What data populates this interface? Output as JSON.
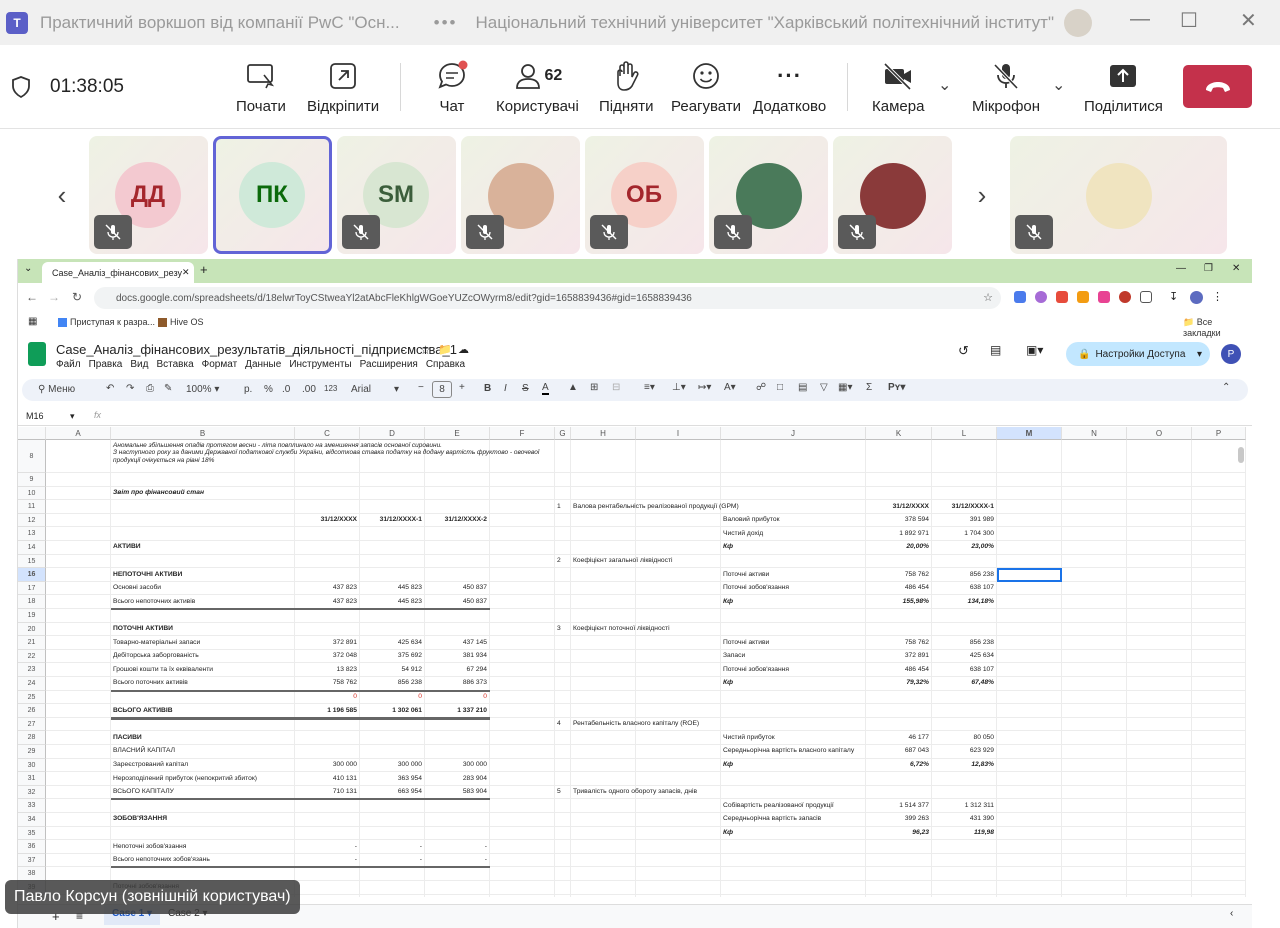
{
  "window": {
    "meeting_title": "Практичний воркшоп від компанії PwC \"Осн...",
    "more": "•••",
    "org_title": "Національний технічний університет \"Харківський політехнічний інститут\""
  },
  "toolbar": {
    "timer": "01:38:05",
    "start": "Почати",
    "undock": "Відкріпити",
    "chat": "Чат",
    "people_count": "62",
    "people": "Користувачі",
    "raise": "Підняти",
    "react": "Реагувати",
    "more": "Додатково",
    "camera": "Камера",
    "mic": "Мікрофон",
    "share": "Поділитися"
  },
  "participants": [
    {
      "initials": "ДД",
      "bg": "#f3c9d0",
      "fg": "#a4262c"
    },
    {
      "initials": "ПК",
      "bg": "#cfe9d9",
      "fg": "#0b6a0b"
    },
    {
      "initials": "SM",
      "bg": "#d8e6d2",
      "fg": "#3b5e3b"
    },
    {
      "initials": "",
      "photo": "#d9b29a"
    },
    {
      "initials": "ОБ",
      "bg": "#f6d0c8",
      "fg": "#a4262c"
    },
    {
      "initials": "",
      "photo": "#4a7a5a"
    },
    {
      "initials": "",
      "photo": "#8a3a3a"
    }
  ],
  "browser": {
    "tab_title": "Case_Аналіз_фінансових_резу",
    "url": "docs.google.com/spreadsheets/d/18elwrToyCStweaYl2atAbcFleKhlgWGoeYUZcOWyrm8/edit?gid=1658839436#gid=1658839436",
    "bookmark1": "Приступая к разра...",
    "bookmark2": "Hive OS",
    "bookmarks_all": "Все закладки"
  },
  "sheets": {
    "title": "Case_Аналіз_фінансових_результатів_діяльності_підприємства_1",
    "menus": [
      "Файл",
      "Правка",
      "Вид",
      "Вставка",
      "Формат",
      "Данные",
      "Инструменты",
      "Расширения",
      "Справка"
    ],
    "share": "Настройки Доступа",
    "avatar": "P",
    "search": "Меню",
    "zoom": "100%",
    "font": "Arial",
    "font_size": "8",
    "cellref": "M16",
    "fx": "fx",
    "tabs": [
      "Case 1",
      "Case 2"
    ]
  },
  "columns": [
    "A",
    "B",
    "C",
    "D",
    "E",
    "F",
    "G",
    "H",
    "I",
    "J",
    "K",
    "L",
    "M",
    "N",
    "O",
    "P"
  ],
  "rows": [
    "8",
    "9",
    "10",
    "11",
    "12",
    "13",
    "14",
    "15",
    "16",
    "17",
    "18",
    "19",
    "20",
    "21",
    "22",
    "23",
    "24",
    "25",
    "26",
    "27",
    "28",
    "29",
    "30",
    "31",
    "32",
    "33",
    "34",
    "35",
    "36",
    "37",
    "38",
    "39"
  ],
  "note": "Аномальне збільшення опадів протягом весни - літа повплинало на зменшення запасів основної сировини.\nЗ наступного року за даними Державної податкової служби України, відсоткова ставка податку на додану вартість фруктово - овочевої продукції очікується на рівні 18%",
  "left_cells": [
    {
      "r": "10",
      "t": "Звіт про фінансовий стан",
      "s": "b i"
    },
    {
      "r": "12",
      "c": "31/12/XXXX",
      "d": "31/12/XXXX-1",
      "e": "31/12/XXXX-2"
    },
    {
      "r": "14",
      "t": "АКТИВИ",
      "s": "b"
    },
    {
      "r": "16",
      "t": "НЕПОТОЧНІ АКТИВИ",
      "s": "b"
    },
    {
      "r": "17",
      "t": "Основні засоби",
      "c": "437 823",
      "d": "445 823",
      "e": "450 837"
    },
    {
      "r": "18",
      "t": "Всього непоточних активів",
      "c": "437 823",
      "d": "445 823",
      "e": "450 837"
    },
    {
      "r": "20",
      "t": "ПОТОЧНІ АКТИВИ",
      "s": "b"
    },
    {
      "r": "21",
      "t": "Товарно-матеріальні запаси",
      "c": "372 891",
      "d": "425 634",
      "e": "437 145"
    },
    {
      "r": "22",
      "t": "Дебіторська заборгованість",
      "c": "372 048",
      "d": "375 692",
      "e": "381 934"
    },
    {
      "r": "23",
      "t": "Грошові кошти та їх еквіваленти",
      "c": "13 823",
      "d": "54 912",
      "e": "67 294"
    },
    {
      "r": "24",
      "t": "Всього поточних активів",
      "c": "758 762",
      "d": "856 238",
      "e": "886 373"
    },
    {
      "r": "25",
      "c": "0",
      "d": "0",
      "e": "0",
      "red": true
    },
    {
      "r": "26",
      "t": "ВСЬОГО АКТИВІВ",
      "s": "b",
      "c": "1 196 585",
      "d": "1 302 061",
      "e": "1 337 210"
    },
    {
      "r": "28",
      "t": "ПАСИВИ",
      "s": "b"
    },
    {
      "r": "29",
      "t": "ВЛАСНИЙ КАПІТАЛ"
    },
    {
      "r": "30",
      "t": "Зареєстрований капітал",
      "c": "300 000",
      "d": "300 000",
      "e": "300 000"
    },
    {
      "r": "31",
      "t": "Нерозподілений прибуток (непокритий збиток)",
      "c": "410 131",
      "d": "363 954",
      "e": "283 904"
    },
    {
      "r": "32",
      "t": "ВСЬОГО КАПІТАЛУ",
      "c": "710 131",
      "d": "663 954",
      "e": "583 904"
    },
    {
      "r": "34",
      "t": "ЗОБОВ'ЯЗАННЯ",
      "s": "b"
    },
    {
      "r": "36",
      "t": "Непоточні зобов'язання",
      "c": "-",
      "d": "-",
      "e": "-"
    },
    {
      "r": "37",
      "t": "Всього непоточних зобов'язань",
      "c": "-",
      "d": "-",
      "e": "-"
    },
    {
      "r": "39",
      "t": "Поточні зобов'язання"
    }
  ],
  "right_cells": [
    {
      "r": "11",
      "g": "1",
      "h": "Валова рентабельність реалізованої продукції (GPM)",
      "k": "31/12/XXXX",
      "l": "31/12/XXXX-1"
    },
    {
      "r": "12",
      "j": "Валовий прибуток",
      "k": "378 594",
      "l": "391 989"
    },
    {
      "r": "13",
      "j": "Чистий дохід",
      "k": "1 892 971",
      "l": "1 704 300"
    },
    {
      "r": "14",
      "j": "Кф",
      "k": "20,00%",
      "l": "23,00%",
      "s": "b i"
    },
    {
      "r": "15",
      "g": "2",
      "h": "Коефіцієнт загальної ліквідності"
    },
    {
      "r": "16",
      "j": "Поточні активи",
      "k": "758 762",
      "l": "856 238"
    },
    {
      "r": "17",
      "j": "Поточні зобов'язання",
      "k": "486 454",
      "l": "638 107"
    },
    {
      "r": "18",
      "j": "Кф",
      "k": "155,98%",
      "l": "134,18%",
      "s": "b i"
    },
    {
      "r": "20",
      "g": "3",
      "h": "Коефіцієнт поточної ліквідності"
    },
    {
      "r": "21",
      "j": "Поточні активи",
      "k": "758 762",
      "l": "856 238"
    },
    {
      "r": "22",
      "j": "Запаси",
      "k": "372 891",
      "l": "425 634"
    },
    {
      "r": "23",
      "j": "Поточні зобов'язання",
      "k": "486 454",
      "l": "638 107"
    },
    {
      "r": "24",
      "j": "Кф",
      "k": "79,32%",
      "l": "67,48%",
      "s": "b i"
    },
    {
      "r": "27",
      "g": "4",
      "h": "Рентабельність власного капіталу (ROE)"
    },
    {
      "r": "28",
      "j": "Чистий прибуток",
      "k": "46 177",
      "l": "80 050"
    },
    {
      "r": "29",
      "j": "Середньорічна вартість власного капіталу",
      "k": "687 043",
      "l": "623 929"
    },
    {
      "r": "30",
      "j": "Кф",
      "k": "6,72%",
      "l": "12,83%",
      "s": "b i"
    },
    {
      "r": "32",
      "g": "5",
      "h": "Тривалість одного обороту запасів, днів"
    },
    {
      "r": "33",
      "j": "Собівартість реалізованої продукції",
      "k": "1 514 377",
      "l": "1 312 311"
    },
    {
      "r": "34",
      "j": "Середньорічна вартість запасів",
      "k": "399 263",
      "l": "431 390"
    },
    {
      "r": "35",
      "j": "Кф",
      "k": "96,23",
      "l": "119,98",
      "s": "b i"
    }
  ],
  "presenter": "Павло Корсун (зовнішній користувач)"
}
